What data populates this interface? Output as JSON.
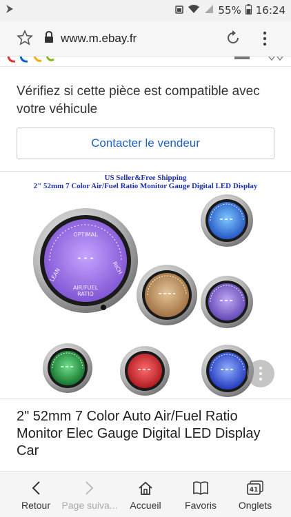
{
  "status_bar": {
    "battery": "55%",
    "time": "16:24"
  },
  "address_bar": {
    "url": "www.m.ebay.fr"
  },
  "compat": {
    "text": "Vérifiez si cette pièce est compatible avec votre véhicule"
  },
  "contact_button": {
    "label": "Contacter le vendeur"
  },
  "product_image": {
    "line1": "US Seller&Free Shipping",
    "line2": "2\" 52mm 7 Color Air/Fuel Ratio Monitor Gauge Digital LED Display",
    "gauge_labels": {
      "optimal": "OPTIMAL",
      "lean": "LEAN",
      "rich": "RICH",
      "air_fuel": "AIR/FUEL",
      "ratio": "RATIO",
      "dashes": "- - -"
    },
    "colors": {
      "purple": "#a678e6",
      "amber": "#c9a070",
      "violet": "#8d6fe0",
      "blue": "#2f7fe6",
      "green": "#1f9a3c",
      "red": "#e0262e",
      "deep_blue": "#2b55e6"
    }
  },
  "product": {
    "title": "2\" 52mm 7 Color Auto Air/Fuel Ratio Monitor Elec Gauge Digital LED Display Car"
  },
  "bottom_nav": {
    "back": "Retour",
    "forward": "Page suiva...",
    "home": "Accueil",
    "favorites": "Favoris",
    "tabs": "Onglets",
    "tab_count": "41"
  }
}
